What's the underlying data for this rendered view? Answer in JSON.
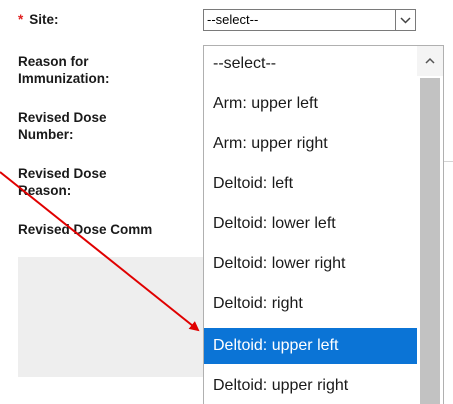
{
  "form": {
    "site_label": "Site:",
    "required_marker": "*",
    "reason_label": "Reason for Immunization:",
    "revised_dose_number_label": "Revised Dose Number:",
    "revised_dose_reason_label": "Revised Dose Reason:",
    "revised_dose_comments_label": "Revised Dose Comm"
  },
  "site_select": {
    "value": "--select--",
    "options": [
      "--select--",
      "Arm: upper left",
      "Arm: upper right",
      "Deltoid: left",
      "Deltoid: lower left",
      "Deltoid: lower right",
      "Deltoid: right",
      "Deltoid: upper left",
      "Deltoid: upper right"
    ],
    "highlighted_option": "Deltoid: upper left"
  },
  "colors": {
    "highlight": "#0b74d6",
    "annotation_arrow": "#e00000",
    "required": "#e02020"
  },
  "icons": {
    "select_toggle": "chevron-down-icon",
    "scroll_up": "chevron-up-icon",
    "annotation": "red-arrow"
  }
}
